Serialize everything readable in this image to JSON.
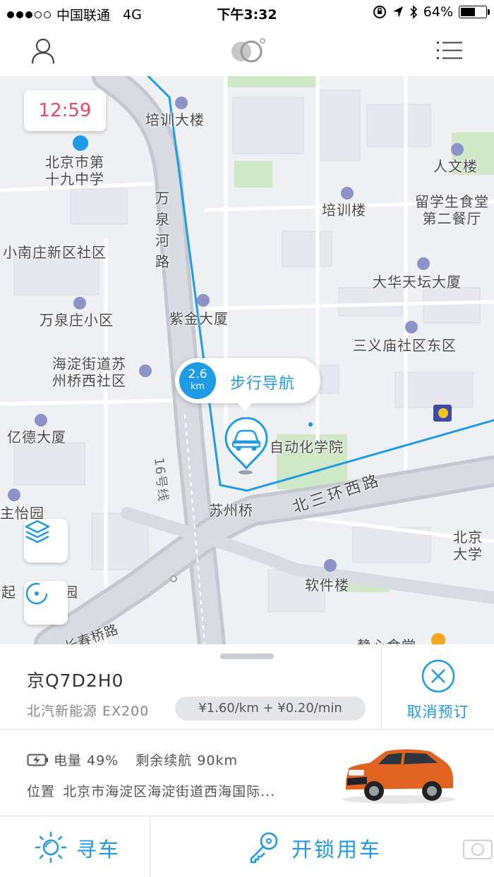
{
  "status_bar": {
    "carrier": "中国联通",
    "network": "4G",
    "time": "下午3:32",
    "battery": "64%",
    "battery_level": 0.64
  },
  "header": {
    "profile_icon": "user-icon",
    "logo_icon": "app-logo-icon",
    "menu_icon": "list-menu-icon"
  },
  "map": {
    "clock": "12:59",
    "labels": {
      "peixun_dalou": "培训大楼",
      "beijing_19": "北京市第\n十九中学",
      "wanquanhe": "万\n泉\n河\n路",
      "renwenlou": "人文楼",
      "peixunlou": "培训楼",
      "liuxuesheng": "留学生食堂\n第二餐厅",
      "xiaonanzhuang": "小南庄新区社区",
      "dahua": "大华天坛大厦",
      "wanquanzhuang": "万泉庄小区",
      "zijin": "紫金大厦",
      "sanyimiao": "三义庙社区东区",
      "haidian_suzhou": "海淀街道苏\n州桥西社区",
      "yide": "亿德大厦",
      "zidonghua": "自动化学院",
      "line16": "16号线",
      "suzhouqiao": "苏州桥",
      "beisanhuan": "北三环西路",
      "zhuyi": "主怡园",
      "beijing_daxue": "北京\n大学",
      "ruanjianlou": "软件楼",
      "qi_yuan": "起",
      "yuan_tail": "园",
      "changchunqiao": "长春桥路",
      "bottom_cut": "静心食堂"
    },
    "layers_icon": "layers-icon",
    "locate_icon": "locate-icon",
    "car_marker_icon": "car-marker-icon",
    "nav_bubble": {
      "distance": "2.6",
      "unit": "km",
      "label": "步行导航"
    }
  },
  "panel": {
    "plate": "京Q7D2H0",
    "model": "北汽新能源 EX200",
    "price": "¥1.60/km + ¥0.20/min",
    "cancel_label": "取消预订",
    "cancel_icon": "cancel-x-icon",
    "battery_icon": "battery-charge-icon",
    "battery_text": "电量 49%",
    "range_text": "剩余续航 90km",
    "location_label": "位置",
    "location_text": "北京市海淀区海淀街道西海国际...",
    "car_image_icon": "orange-suv-image",
    "find_label": "寻车",
    "find_icon": "sun-flash-icon",
    "unlock_label": "开锁用车",
    "unlock_icon": "key-icon",
    "accent": "#1e9be6"
  }
}
